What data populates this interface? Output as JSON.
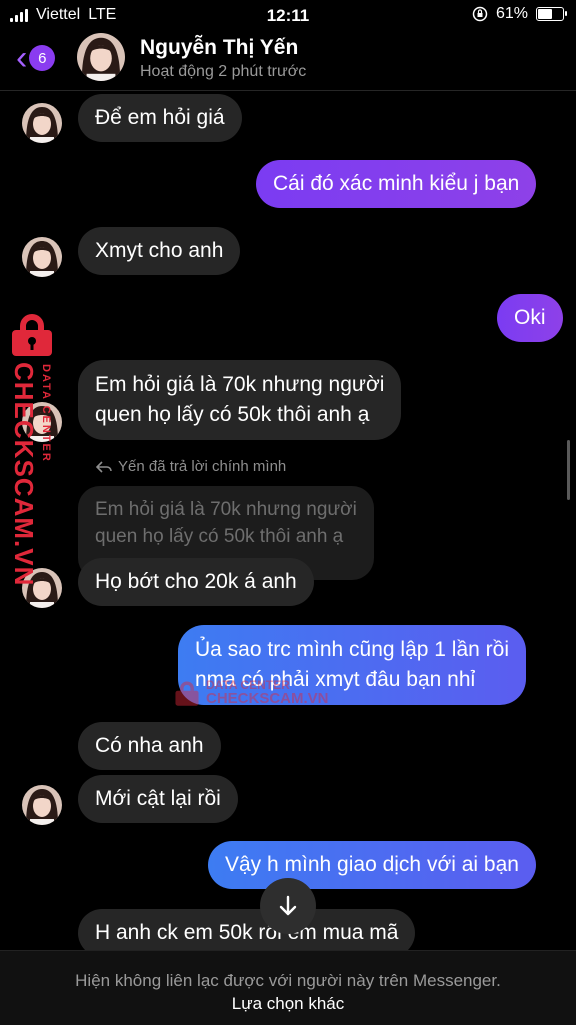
{
  "status_bar": {
    "carrier": "Viettel",
    "network": "LTE",
    "time": "12:11",
    "battery": "61%"
  },
  "header": {
    "back_badge": "6",
    "name": "Nguyễn Thị Yến",
    "status": "Hoạt động 2 phút trước"
  },
  "messages": [
    {
      "dir": "in",
      "text": "Để em hỏi giá"
    },
    {
      "dir": "out",
      "text": "Cái đó xác minh kiểu j bạn"
    },
    {
      "dir": "in",
      "text": "Xmyt cho anh"
    },
    {
      "dir": "out",
      "text": "Oki"
    },
    {
      "dir": "in",
      "lines": [
        "Em hỏi giá là 70k nhưng người",
        "quen họ lấy có 50k thôi anh ạ"
      ]
    },
    {
      "dir": "in",
      "reply_note": "Yến đã trả lời chính mình",
      "quoted_lines": [
        "Em hỏi giá là 70k nhưng người",
        "quen họ lấy có 50k thôi anh ạ"
      ],
      "text": "Họ bớt cho 20k á anh"
    },
    {
      "dir": "out",
      "lines": [
        "Ủa sao trc mình cũng lập 1 lần rồi",
        "nma có phải xmyt đâu bạn nhỉ"
      ]
    },
    {
      "dir": "in",
      "text": "Có nha anh"
    },
    {
      "dir": "in",
      "text": "Mới cật lại rồi"
    },
    {
      "dir": "out",
      "text": "Vậy h mình giao dịch với ai bạn"
    },
    {
      "dir": "in",
      "text": "H anh ck em 50k rồi em mua mã"
    }
  ],
  "watermark": {
    "brand": "CHECKSCAM.VN",
    "sub": "DATA CENTER"
  },
  "footer": {
    "message": "Hiện không liên lạc được với người này trên Messenger.",
    "action": "Lựa chọn khác"
  },
  "colors": {
    "accent_purple": "#8a3cf0",
    "accent_blue": "#3d7cf2",
    "incoming_bubble": "#262626",
    "watermark_red": "#e0283a"
  }
}
